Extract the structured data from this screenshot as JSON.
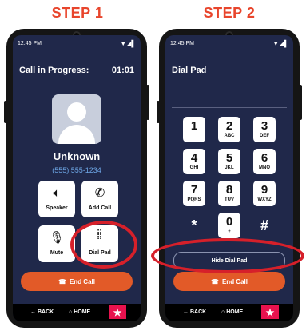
{
  "steps": {
    "one": "STEP 1",
    "two": "STEP 2"
  },
  "status": {
    "time": "12:45 PM",
    "signal": "▼◢▌"
  },
  "call": {
    "title": "Call in Progress:",
    "timer": "01:01",
    "contact_name": "Unknown",
    "contact_number": "(555) 555-1234",
    "actions": [
      {
        "label": "Speaker",
        "icon": "speaker-icon"
      },
      {
        "label": "Add Call",
        "icon": "add-call-icon"
      },
      {
        "label": "Mute",
        "icon": "mute-icon"
      },
      {
        "label": "Dial Pad",
        "icon": "dial-pad-icon"
      }
    ],
    "end_call": "End Call"
  },
  "dialpad": {
    "title": "Dial Pad",
    "keys": [
      {
        "digit": "1",
        "letters": ""
      },
      {
        "digit": "2",
        "letters": "ABC"
      },
      {
        "digit": "3",
        "letters": "DEF"
      },
      {
        "digit": "4",
        "letters": "GHI"
      },
      {
        "digit": "5",
        "letters": "JKL"
      },
      {
        "digit": "6",
        "letters": "MNO"
      },
      {
        "digit": "7",
        "letters": "PQRS"
      },
      {
        "digit": "8",
        "letters": "TUV"
      },
      {
        "digit": "9",
        "letters": "WXYZ"
      },
      {
        "digit": "*",
        "letters": ""
      },
      {
        "digit": "0",
        "letters": "+"
      },
      {
        "digit": "#",
        "letters": ""
      }
    ],
    "hide": "Hide Dial Pad",
    "end_call": "End Call"
  },
  "nav": {
    "back": "BACK",
    "home": "HOME"
  },
  "colors": {
    "accent": "#e8452c",
    "screen": "#20284a",
    "end_call": "#e25a28",
    "highlight": "#d6202a"
  }
}
